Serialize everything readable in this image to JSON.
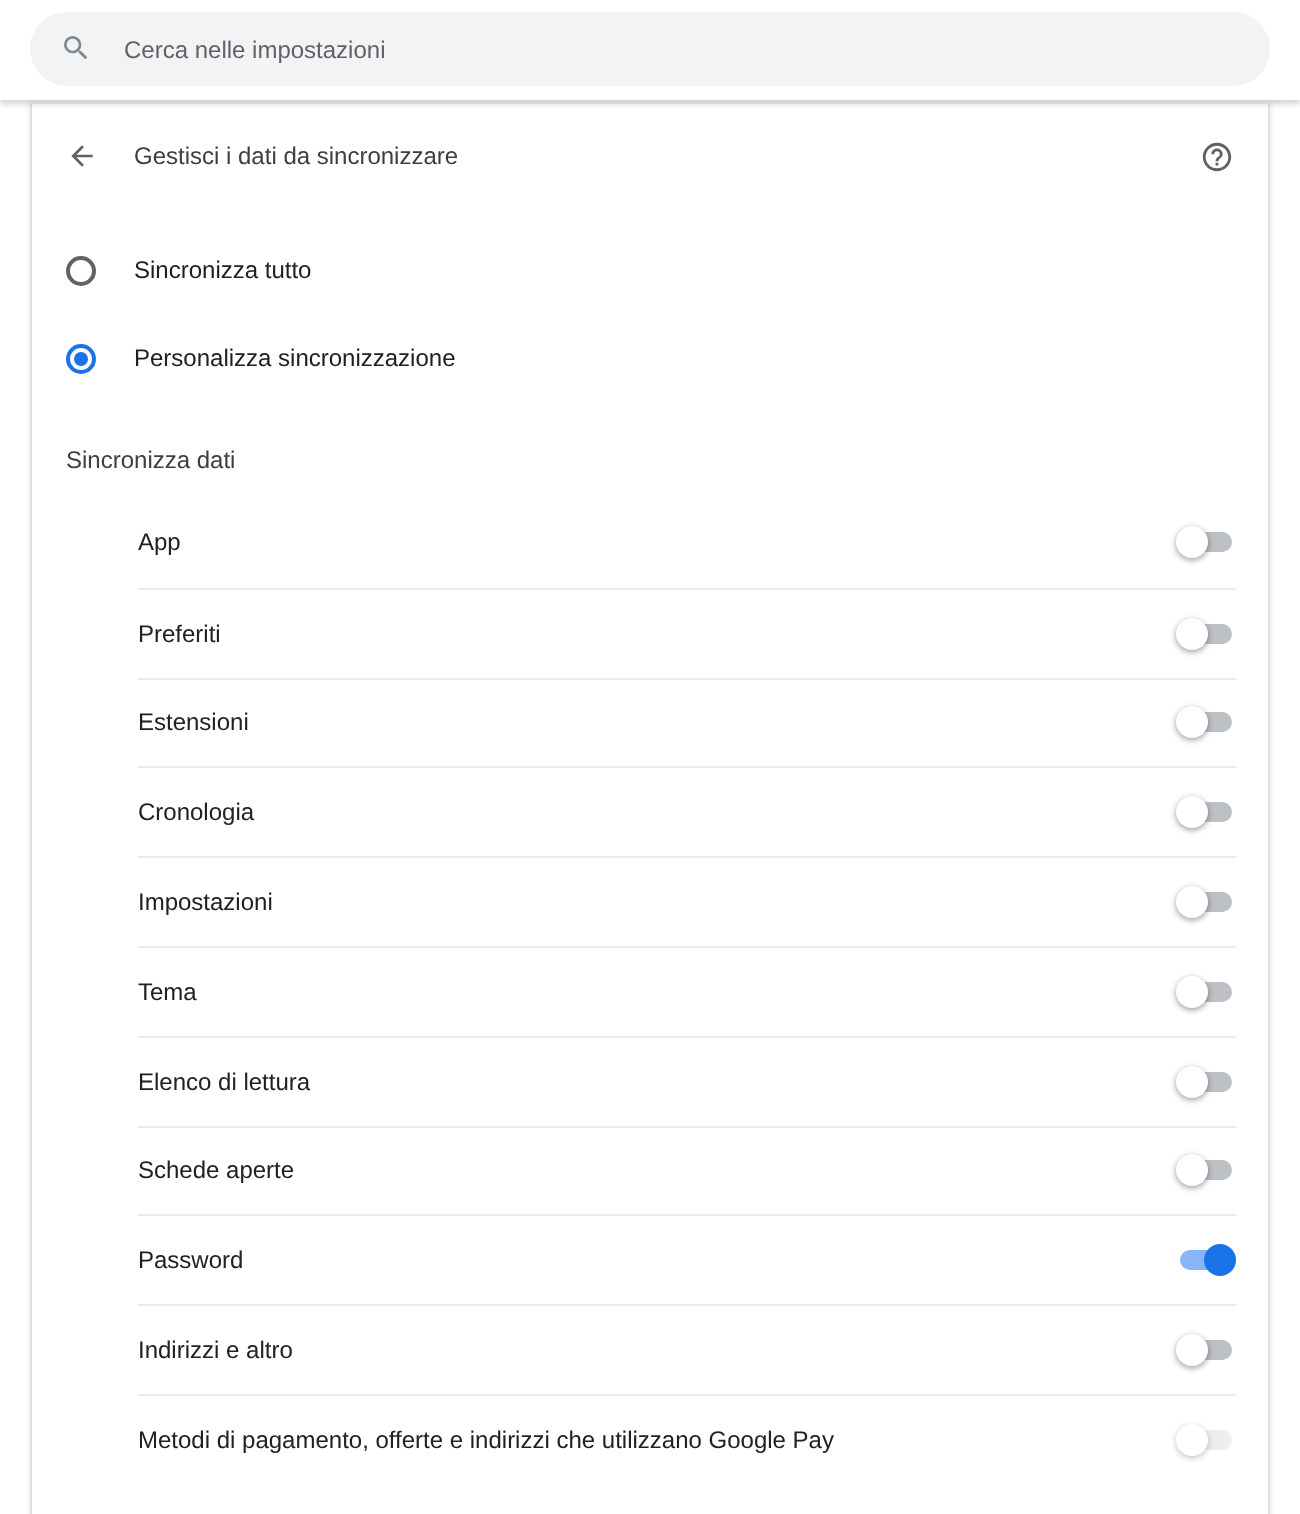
{
  "search": {
    "placeholder": "Cerca nelle impostazioni"
  },
  "header": {
    "title": "Gestisci i dati da sincronizzare"
  },
  "sync_options": [
    {
      "label": "Sincronizza tutto",
      "selected": false
    },
    {
      "label": "Personalizza sincronizzazione",
      "selected": true
    }
  ],
  "section_title": "Sincronizza dati",
  "items": [
    {
      "label": "App",
      "on": false,
      "disabled": false
    },
    {
      "label": "Preferiti",
      "on": false,
      "disabled": false
    },
    {
      "label": "Estensioni",
      "on": false,
      "disabled": false
    },
    {
      "label": "Cronologia",
      "on": false,
      "disabled": false
    },
    {
      "label": "Impostazioni",
      "on": false,
      "disabled": false
    },
    {
      "label": "Tema",
      "on": false,
      "disabled": false
    },
    {
      "label": "Elenco di lettura",
      "on": false,
      "disabled": false
    },
    {
      "label": "Schede aperte",
      "on": false,
      "disabled": false
    },
    {
      "label": "Password",
      "on": true,
      "disabled": false
    },
    {
      "label": "Indirizzi e altro",
      "on": false,
      "disabled": false
    },
    {
      "label": "Metodi di pagamento, offerte e indirizzi che utilizzano Google Pay",
      "on": false,
      "disabled": true
    }
  ]
}
